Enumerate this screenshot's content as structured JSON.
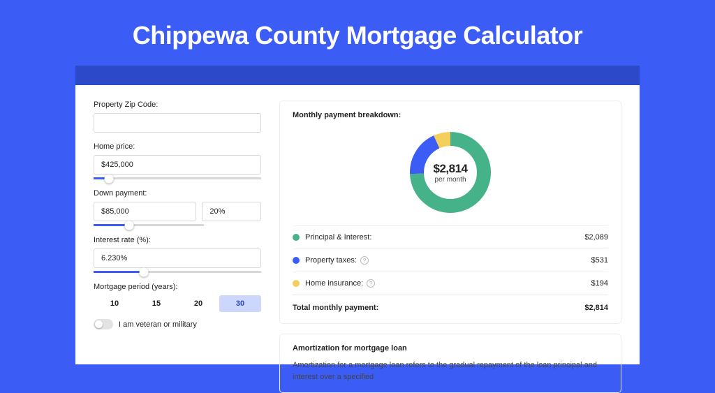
{
  "title": "Chippewa County Mortgage Calculator",
  "form": {
    "zip": {
      "label": "Property Zip Code:",
      "value": ""
    },
    "home_price": {
      "label": "Home price:",
      "value": "$425,000",
      "slider_pct": 9
    },
    "down_payment": {
      "label": "Down payment:",
      "value": "$85,000",
      "pct_value": "20%",
      "slider_pct": 21
    },
    "rate": {
      "label": "Interest rate (%):",
      "value": "6.230%",
      "slider_pct": 30
    },
    "period": {
      "label": "Mortgage period (years):",
      "options": [
        "10",
        "15",
        "20",
        "30"
      ],
      "selected": "30"
    },
    "veteran": {
      "label": "I am veteran or military",
      "on": false
    }
  },
  "breakdown": {
    "title": "Monthly payment breakdown:",
    "donut": {
      "amount": "$2,814",
      "per": "per month"
    },
    "rows": [
      {
        "color": "pi",
        "label": "Principal & Interest:",
        "info": false,
        "value": "$2,089"
      },
      {
        "color": "pt",
        "label": "Property taxes:",
        "info": true,
        "value": "$531"
      },
      {
        "color": "hi",
        "label": "Home insurance:",
        "info": true,
        "value": "$194"
      }
    ],
    "total": {
      "label": "Total monthly payment:",
      "value": "$2,814"
    }
  },
  "amortization": {
    "title": "Amortization for mortgage loan",
    "text": "Amortization for a mortgage loan refers to the gradual repayment of the loan principal and interest over a specified"
  },
  "chart_data": {
    "type": "pie",
    "title": "Monthly payment breakdown",
    "center_label": "$2,814 per month",
    "series": [
      {
        "name": "Principal & Interest",
        "value": 2089,
        "color": "#46b28a"
      },
      {
        "name": "Property taxes",
        "value": 531,
        "color": "#3b5cf5"
      },
      {
        "name": "Home insurance",
        "value": 194,
        "color": "#f4cf5c"
      }
    ],
    "total": 2814
  }
}
